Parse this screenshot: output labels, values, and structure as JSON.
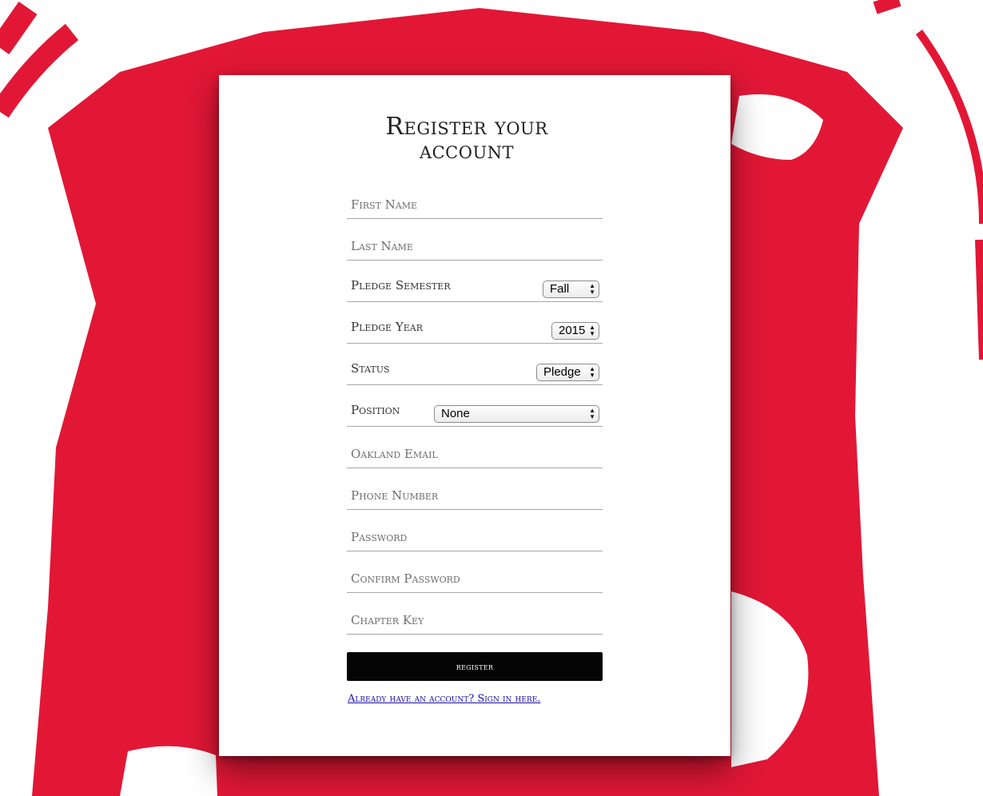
{
  "colors": {
    "background_red": "#e21736",
    "card_bg": "#ffffff",
    "button_bg": "#050505",
    "link": "#1a0dab"
  },
  "form": {
    "title_line1": "Register your",
    "title_line2": "account",
    "first_name_placeholder": "First Name",
    "last_name_placeholder": "Last Name",
    "pledge_semester_label": "Pledge Semester",
    "pledge_semester_value": "Fall",
    "pledge_year_label": "Pledge Year",
    "pledge_year_value": "2015",
    "status_label": "Status",
    "status_value": "Pledge",
    "position_label": "Position",
    "position_value": "None",
    "oakland_email_placeholder": "Oakland Email",
    "phone_number_placeholder": "Phone Number",
    "password_placeholder": "Password",
    "confirm_password_placeholder": "Confirm Password",
    "chapter_key_placeholder": "Chapter Key",
    "register_label": "register",
    "signin_link": "Already have an account? Sign in here."
  }
}
